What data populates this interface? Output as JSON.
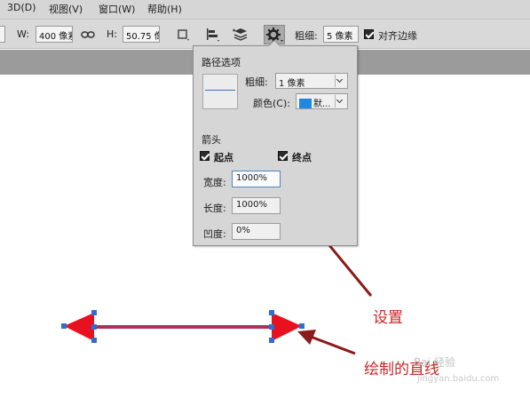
{
  "menu": {
    "items": [
      "3D(D)",
      "视图(V)",
      "窗口(W)",
      "帮助(H)"
    ]
  },
  "options_bar": {
    "w_label": "W:",
    "w_value": "400 像素",
    "h_label": "H:",
    "h_value": "50.75 像",
    "weight_label": "粗细:",
    "weight_value": "5 像素",
    "align_edges_label": "对齐边缘",
    "align_edges_checked": true
  },
  "path_options": {
    "title": "路径选项",
    "weight_label": "粗细:",
    "weight_value": "1 像素",
    "color_label": "颜色(C):",
    "color_value": "默...",
    "color_swatch": "#1e88e5",
    "arrow_section": "箭头",
    "start_label": "起点",
    "start_checked": true,
    "end_label": "终点",
    "end_checked": true,
    "width_label": "宽度:",
    "width_value": "1000%",
    "length_label": "长度:",
    "length_value": "1000%",
    "concavity_label": "凹度:",
    "concavity_value": "0%"
  },
  "annotations": {
    "settings_label": "设置",
    "line_label": "绘制的直线"
  },
  "colors": {
    "arrowhead": "#e8111f",
    "shaft": "#a8325a",
    "annotation_arrow": "#8b1a1a",
    "annotation_text": "#c62828",
    "anchor": "#2d6fd1"
  },
  "watermark": {
    "text": "Bai 经验",
    "sub": "jingyan.baidu.com"
  }
}
